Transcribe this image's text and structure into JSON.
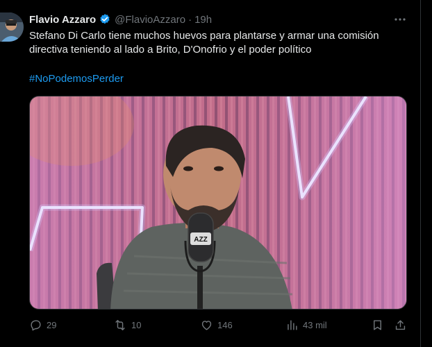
{
  "tweet": {
    "author_name": "Flavio Azzaro",
    "handle": "@FlavioAzzaro",
    "separator": "·",
    "time": "19h",
    "text": "Stefano Di Carlo tiene muchos huevos para plantarse y armar una comisión directiva teniendo al lado a Brito, D'Onofrio y el poder político",
    "hashtag": "#NoPodemosPerder"
  },
  "actions": {
    "replies": "29",
    "reposts": "10",
    "likes": "146",
    "views": "43 mil"
  },
  "icons": {
    "verified": "verified-badge-icon",
    "more": "more-dots-icon",
    "reply": "reply-icon",
    "repost": "repost-icon",
    "like": "heart-icon",
    "views": "views-icon",
    "bookmark": "bookmark-icon",
    "share": "share-icon"
  },
  "media": {
    "mic_logo": "AZZ"
  },
  "colors": {
    "background": "#000000",
    "text": "#e7e9ea",
    "muted": "#71767b",
    "link": "#1d9bf0",
    "verified": "#1d9bf0"
  }
}
